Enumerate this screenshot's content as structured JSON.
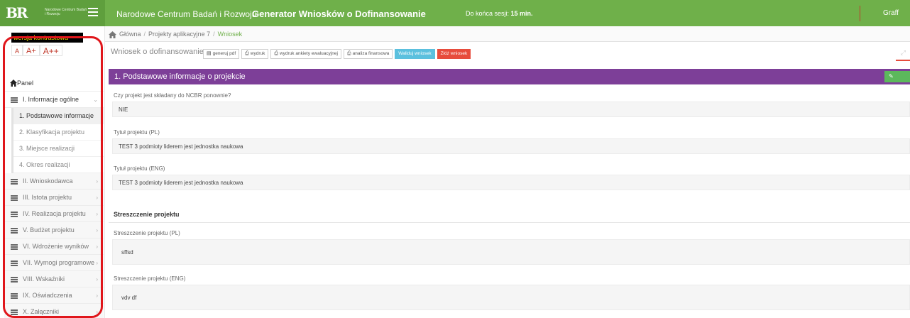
{
  "header": {
    "logo_text": "Narodowe Centrum Badań i Rozwoju",
    "org_name": "Narodowe Centrum Badań i Rozwoju",
    "app_title": "Generator Wniosków o Dofinansowanie",
    "session_label": "Do końca sesji:",
    "session_value": "15 min.",
    "user": "Graff",
    "brand_color": "#6fb04a"
  },
  "accessibility": {
    "contrast_label": "wersja kontrastowa",
    "font_small": "A",
    "font_medium": "A+",
    "font_large": "A++"
  },
  "breadcrumb": {
    "items": [
      "Główna",
      "Projekty aplikacyjne 7",
      "Wniosek"
    ]
  },
  "toolbar": {
    "title": "Wniosek o dofinansowanie",
    "buttons": {
      "pdf": "generuj pdf",
      "print": "wydruk",
      "print_survey": "wydruk ankiety ewaluacyjnej",
      "financial": "analiza finansowa",
      "validate": "Waliduj wniosek",
      "submit": "Złóż wniosek"
    }
  },
  "sidebar": {
    "panel": "Panel",
    "items": [
      {
        "label": "I. Informacje ogólne",
        "expanded": true,
        "children": [
          "1. Podstawowe informacje",
          "2. Klasyfikacja projektu",
          "3. Miejsce realizacji",
          "4. Okres realizacji"
        ]
      },
      {
        "label": "II. Wnioskodawca"
      },
      {
        "label": "III. Istota projektu"
      },
      {
        "label": "IV. Realizacja projektu"
      },
      {
        "label": "V. Budżet projektu"
      },
      {
        "label": "VI. Wdrożenie wyników"
      },
      {
        "label": "VII. Wymogi programowe"
      },
      {
        "label": "VIII. Wskaźniki"
      },
      {
        "label": "IX. Oświadczenia"
      },
      {
        "label": "X. Załączniki"
      }
    ],
    "active_child": "1. Podstawowe informacje"
  },
  "section": {
    "title": "1. Podstawowe informacje o projekcie",
    "edit_label": "edytuj",
    "header_color": "#7d3f98"
  },
  "form": {
    "resubmitted_label": "Czy projekt jest składany do NCBR ponownie?",
    "resubmitted_value": "NIE",
    "title_pl_label": "Tytuł projektu (PL)",
    "title_pl_value": "TEST 3 podmioty liderem jest jednostka naukowa",
    "title_eng_label": "Tytuł projektu (ENG)",
    "title_eng_value": "TEST 3 podmioty liderem jest jednostka naukowa",
    "summary_heading": "Streszczenie projektu",
    "summary_pl_label": "Streszczenie projektu (PL)",
    "summary_pl_value": "sffsd",
    "summary_eng_label": "Streszczenie projektu (ENG)",
    "summary_eng_value": "vdv df"
  }
}
